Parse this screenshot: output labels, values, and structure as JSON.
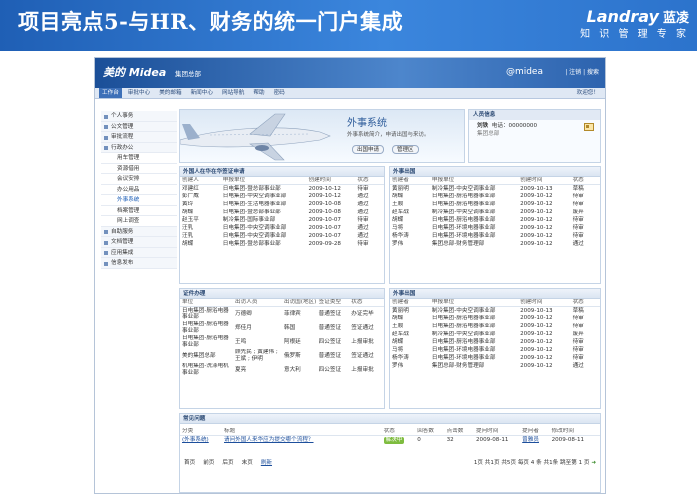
{
  "slide": {
    "title": "项目亮点5-与HR、财务的统一门户集成",
    "brand_name": "Landray",
    "brand_cn": "蓝凌",
    "slogan": "知 识 管 理 专 家",
    "colors": {
      "header": "#2f78d0",
      "text": "#ffffff"
    }
  },
  "app": {
    "logo": "美的 Midea",
    "group": "集团总部",
    "at_text": "@midea",
    "links": "| 注销 | 搜索",
    "welcome": "欢迎您！",
    "nav": [
      "工作台",
      "审批中心",
      "美的邮箱",
      "新闻中心",
      "网站导航",
      "帮助",
      "密码"
    ],
    "nav_active": "工作台"
  },
  "sidebar": [
    {
      "label": "个人事务",
      "sub": false
    },
    {
      "label": "公文管理",
      "sub": false
    },
    {
      "label": "审批流程",
      "sub": false
    },
    {
      "label": "行政办公",
      "sub": false
    },
    {
      "label": "用车管理",
      "sub": true
    },
    {
      "label": "资源借用",
      "sub": true
    },
    {
      "label": "会议安排",
      "sub": true
    },
    {
      "label": "办公用品",
      "sub": true
    },
    {
      "label": "外事系统",
      "sub": true,
      "current": true
    },
    {
      "label": "档案管理",
      "sub": true
    },
    {
      "label": "网上调查",
      "sub": true
    },
    {
      "label": "自助服务",
      "sub": false
    },
    {
      "label": "文档管理",
      "sub": false
    },
    {
      "label": "应用集成",
      "sub": false
    },
    {
      "label": "信息发布",
      "sub": false
    }
  ],
  "banner": {
    "title": "外事系统",
    "desc": "外事系统简介，申请出国与来访。",
    "btn_apply": "出国申请",
    "btn_manage": "管理区"
  },
  "people": {
    "title": "人员信息",
    "name": "刘铁",
    "phone": "电话：00000000",
    "dept": "集团总部"
  },
  "visitors": {
    "title": "外国人在华在华签证申请",
    "headers": [
      "创建人",
      "申报单位",
      "创建时间",
      "状态"
    ],
    "rows": [
      [
        "邓建红",
        "日电集团-暨总部事业部",
        "2009-10-12",
        "待审"
      ],
      [
        "彭广威",
        "日电集团-中央空调事业部",
        "2009-10-12",
        "通过"
      ],
      [
        "黄玲",
        "日电集团-生活电器事业部",
        "2009-10-08",
        "通过"
      ],
      [
        "胡蝶",
        "日电集团-暨总部事业部",
        "2009-10-08",
        "通过"
      ],
      [
        "赵玉平",
        "制冷集团-国际事业部",
        "2009-10-07",
        "待审"
      ],
      [
        "汪乳",
        "日电集团-中央空调事业部",
        "2009-10-07",
        "通过"
      ],
      [
        "汪乳",
        "日电集团-中央空调事业部",
        "2009-10-07",
        "通过"
      ],
      [
        "胡蝶",
        "日电集团-暨总部事业部",
        "2009-09-28",
        "待审"
      ]
    ]
  },
  "outbound1": {
    "title": "外事出国",
    "headers": [
      "创建者",
      "申报单位",
      "创建时间",
      "状态"
    ],
    "rows": [
      [
        "黄丽明",
        "制冷集团-中央空调事业部",
        "2009-10-13",
        "草稿"
      ],
      [
        "胡蝶",
        "日电集团-厨浴电器事业部",
        "2009-10-12",
        "待审"
      ],
      [
        "王顺",
        "日电集团-厨浴电器事业部",
        "2009-10-12",
        "待审"
      ],
      [
        "赵军战",
        "制冷集团-中央空调事业部",
        "2009-10-12",
        "废弃"
      ],
      [
        "胡蝶",
        "日电集团-厨浴电器事业部",
        "2009-10-12",
        "待审"
      ],
      [
        "马将",
        "日电集团-环境电器事业部",
        "2009-10-12",
        "待审"
      ],
      [
        "杨华涛",
        "日电集团-环境电器事业部",
        "2009-10-12",
        "待审"
      ],
      [
        "罗伟",
        "集团总部-财务管理部",
        "2009-10-12",
        "通过"
      ]
    ]
  },
  "visa": {
    "title": "证件办理",
    "headers": [
      "单位",
      "出访人员",
      "出访国(地区)",
      "签证类型",
      "状态"
    ],
    "rows": [
      [
        "日电集团-厨浴电器事业部",
        "万德卿",
        "菲律宾",
        "普通签证",
        "办证完毕"
      ],
      [
        "日电集团-厨浴电器事业部",
        "郑佳月",
        "韩国",
        "普通签证",
        "签证通过"
      ],
      [
        "日电集团-厨浴电器事业部",
        "王鸣",
        "阿根廷",
        "四公签证",
        "上报审批"
      ],
      [
        "美的集团总部",
        "顾先民 ; 黄建伟 ; 王斌 ; 伊明",
        "俄罗斯",
        "普通签证",
        "签证通过"
      ],
      [
        "机电集团-洗涤电机事业部",
        "夏亮",
        "意大利",
        "四公签证",
        "上报审批"
      ]
    ]
  },
  "outbound2": {
    "title": "外事出国",
    "headers": [
      "创建者",
      "申报单位",
      "创建时间",
      "状态"
    ],
    "rows": [
      [
        "黄丽明",
        "制冷集团-中央空调事业部",
        "2009-10-13",
        "草稿"
      ],
      [
        "胡蝶",
        "日电集团-厨浴电器事业部",
        "2009-10-12",
        "待审"
      ],
      [
        "王顺",
        "日电集团-厨浴电器事业部",
        "2009-10-12",
        "待审"
      ],
      [
        "赵军战",
        "制冷集团-中央空调事业部",
        "2009-10-12",
        "废弃"
      ],
      [
        "胡蝶",
        "日电集团-厨浴电器事业部",
        "2009-10-12",
        "待审"
      ],
      [
        "马将",
        "日电集团-环境电器事业部",
        "2009-10-12",
        "待审"
      ],
      [
        "杨华涛",
        "日电集团-环境电器事业部",
        "2009-10-12",
        "待审"
      ],
      [
        "罗伟",
        "集团总部-财务管理部",
        "2009-10-12",
        "通过"
      ]
    ]
  },
  "faq": {
    "title": "常见问题",
    "headers": [
      "分类",
      "标题",
      "状态",
      "回答数",
      "点击数",
      "提问时间",
      "提问者",
      "修改时间"
    ],
    "row": [
      "(外事系统)",
      "请问外国人来华应为提交哪个流程？",
      "解决中",
      "0",
      "32",
      "2009-08-11",
      "曾雅员",
      "2009-08-11"
    ],
    "pager_left": [
      "首页",
      "前页",
      "后页",
      "末页",
      "刷新"
    ],
    "pager_right": "1页 共1页 共5页 每页 4 条 共1条 跳至第 1 页"
  }
}
